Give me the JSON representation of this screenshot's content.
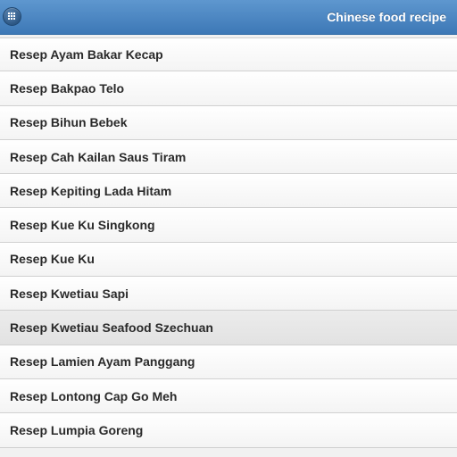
{
  "header": {
    "title": "Chinese food recipe",
    "menu_icon": "grid-menu-icon",
    "accent_color": "#4a86c3"
  },
  "recipes": [
    {
      "label": "Resep Ayam Bakar Kecap"
    },
    {
      "label": "Resep Bakpao Telo"
    },
    {
      "label": "Resep Bihun Bebek"
    },
    {
      "label": "Resep Cah Kailan Saus Tiram"
    },
    {
      "label": "Resep Kepiting Lada Hitam"
    },
    {
      "label": "Resep Kue Ku Singkong"
    },
    {
      "label": "Resep Kue Ku"
    },
    {
      "label": "Resep Kwetiau Sapi"
    },
    {
      "label": "Resep Kwetiau Seafood Szechuan"
    },
    {
      "label": "Resep Lamien Ayam Panggang"
    },
    {
      "label": "Resep Lontong Cap Go Meh"
    },
    {
      "label": "Resep Lumpia Goreng"
    }
  ]
}
